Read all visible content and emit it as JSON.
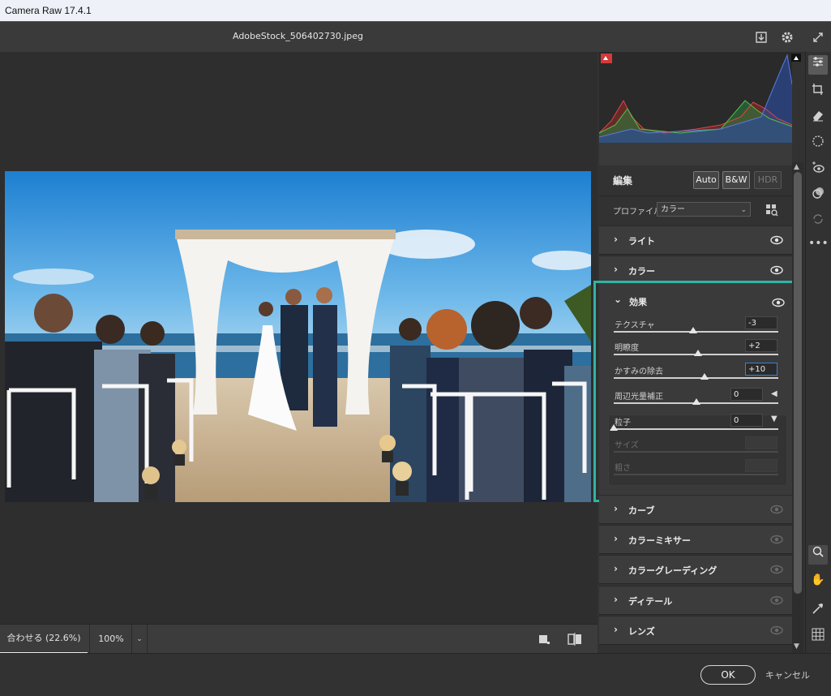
{
  "window": {
    "title": "Camera Raw 17.4.1"
  },
  "header": {
    "filename": "AdobeStock_506402730.jpeg"
  },
  "statusbar": {
    "zoom_fit_label": "合わせる (22.6%)",
    "zoom_100_label": "100%"
  },
  "footer": {
    "ok_label": "OK",
    "cancel_label": "キャンセル"
  },
  "edit": {
    "title": "編集",
    "modes": {
      "auto": "Auto",
      "bw": "B&W",
      "hdr": "HDR"
    },
    "profile_label": "プロファイル",
    "profile_value": "カラー"
  },
  "sections": {
    "light": "ライト",
    "color": "カラー",
    "effects": "効果",
    "curve": "カーブ",
    "color_mixer": "カラーミキサー",
    "color_grading": "カラーグレーディング",
    "detail": "ディテール",
    "lens": "レンズ"
  },
  "effects": {
    "texture": {
      "label": "テクスチャ",
      "value": "-3",
      "level": 0.485
    },
    "clarity": {
      "label": "明瞭度",
      "value": "+2",
      "level": 0.51
    },
    "dehaze": {
      "label": "かすみの除去",
      "value": "+10",
      "level": 0.55
    },
    "vignette": {
      "label": "周辺光量補正",
      "value": "0",
      "level": 0.5
    },
    "grain": {
      "label": "粒子",
      "value": "0",
      "level": 0.0
    },
    "grain_size": {
      "label": "サイズ"
    },
    "grain_roughness": {
      "label": "粗さ"
    }
  },
  "colors": {
    "accent": "#2fb5a3",
    "panel": "#3c3c3c",
    "background": "#323232"
  }
}
